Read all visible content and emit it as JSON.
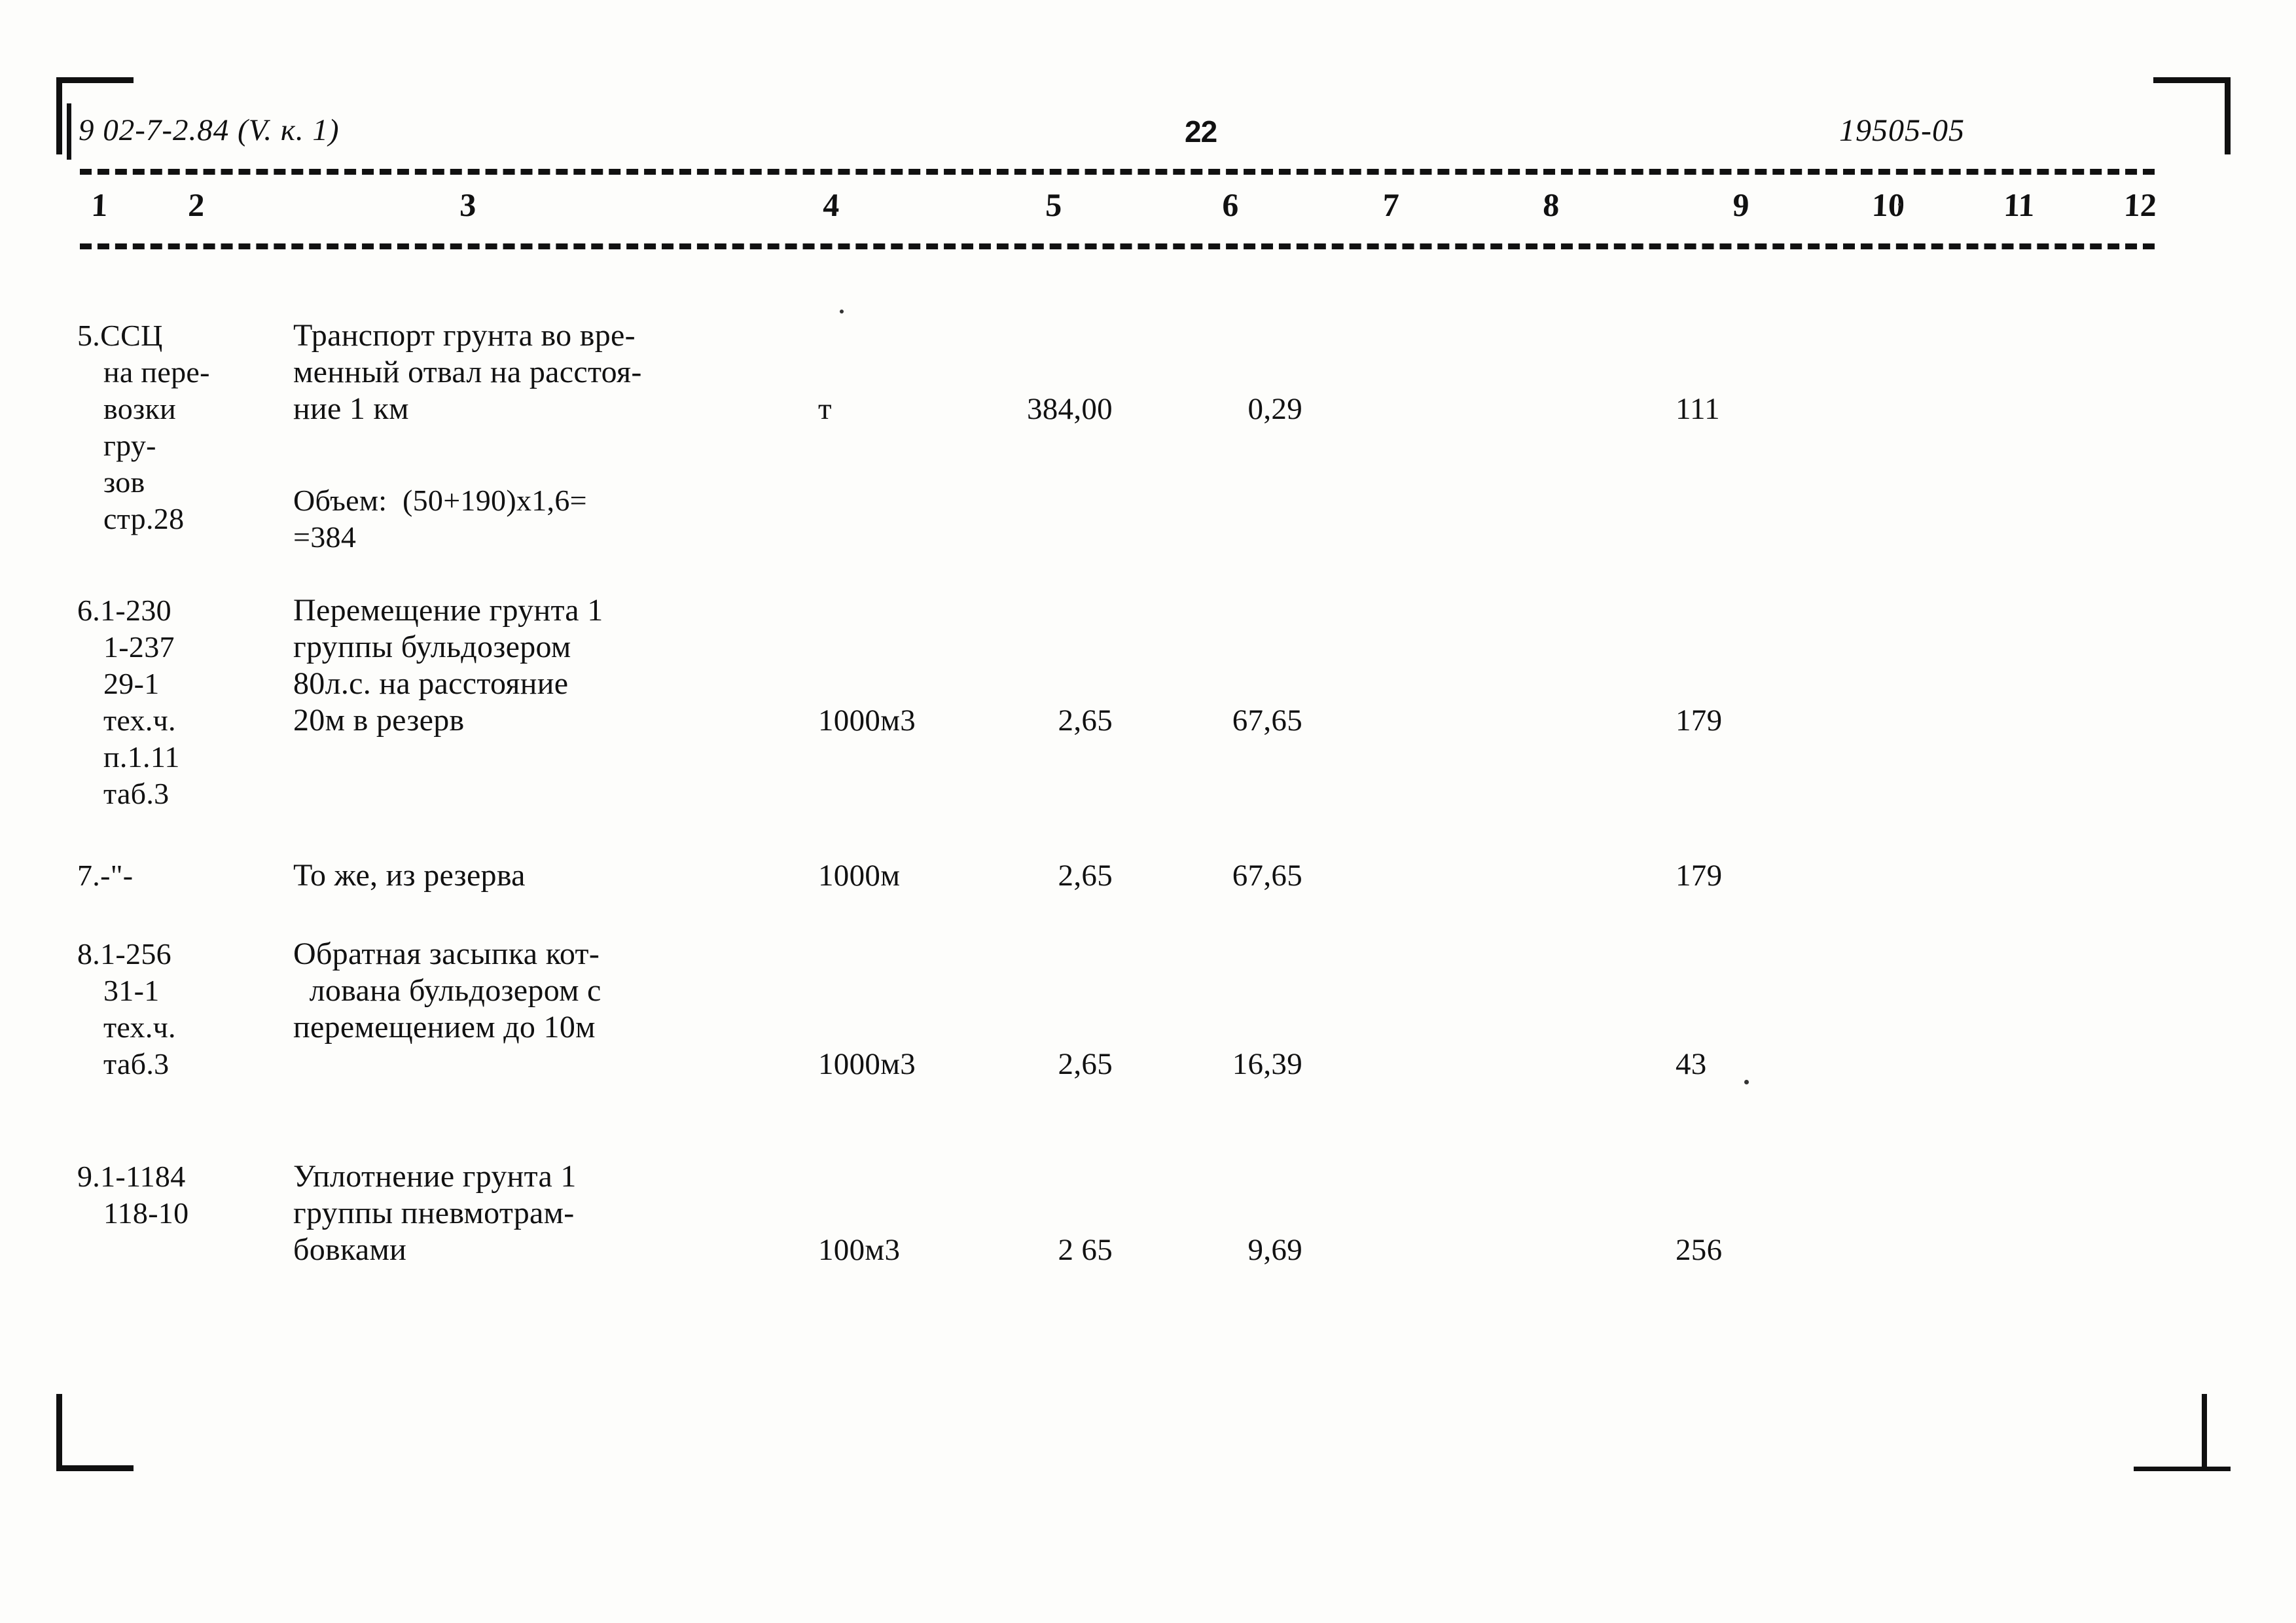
{
  "header": {
    "left_code": "9 02-7-2.84 (V. к. 1)",
    "page_number": "22",
    "right_code": "19505-05"
  },
  "column_numbers": [
    "1",
    "2",
    "3",
    "4",
    "5",
    "6",
    "7",
    "8",
    "9",
    "10",
    "11",
    "12"
  ],
  "rows": [
    {
      "index": "5.",
      "code_lines": [
        "5.ССЦ",
        "на пере-",
        "возки",
        "гру-",
        "зов",
        "стр.28"
      ],
      "desc_lines": [
        "Транспорт грунта во вре-",
        "менный отвал на расстоя-",
        "ние 1 км"
      ],
      "note_lines": [
        "Объем:  (50+190)х1,6=",
        "=384"
      ],
      "unit": "т",
      "qty": "384,00",
      "price": "0,29",
      "col7": "",
      "col8": "",
      "total": "111"
    },
    {
      "index": "6.",
      "code_lines": [
        "6.1-230",
        "1-237",
        "29-1",
        "тех.ч.",
        "п.1.11",
        "таб.3"
      ],
      "desc_lines": [
        "Перемещение грунта 1",
        "группы бульдозером",
        "80л.с. на расстояние",
        "20м в резерв"
      ],
      "note_lines": [],
      "unit": "1000м3",
      "qty": "2,65",
      "price": "67,65",
      "col7": "",
      "col8": "",
      "total": "179"
    },
    {
      "index": "7.",
      "code_lines": [
        "7.-\"-"
      ],
      "desc_lines": [
        "То же, из резерва"
      ],
      "note_lines": [],
      "unit": "1000м",
      "qty": "2,65",
      "price": "67,65",
      "col7": "",
      "col8": "",
      "total": "179"
    },
    {
      "index": "8.",
      "code_lines": [
        "8.1-256",
        "31-1",
        "тех.ч.",
        "таб.3"
      ],
      "desc_lines": [
        "Обратная засыпка кот-",
        "  лована бульдозером с",
        "перемещением до 10м"
      ],
      "note_lines": [],
      "unit": "1000м3",
      "qty": "2,65",
      "price": "16,39",
      "col7": "",
      "col8": "",
      "total": "43"
    },
    {
      "index": "9.",
      "code_lines": [
        "9.1-1184",
        "118-10"
      ],
      "desc_lines": [
        "Уплотнение грунта 1",
        "группы пневмотрам-",
        "бовками"
      ],
      "note_lines": [],
      "unit": "100м3",
      "qty": "2 65",
      "price": "9,69",
      "col7": "",
      "col8": "",
      "total": "256"
    }
  ]
}
